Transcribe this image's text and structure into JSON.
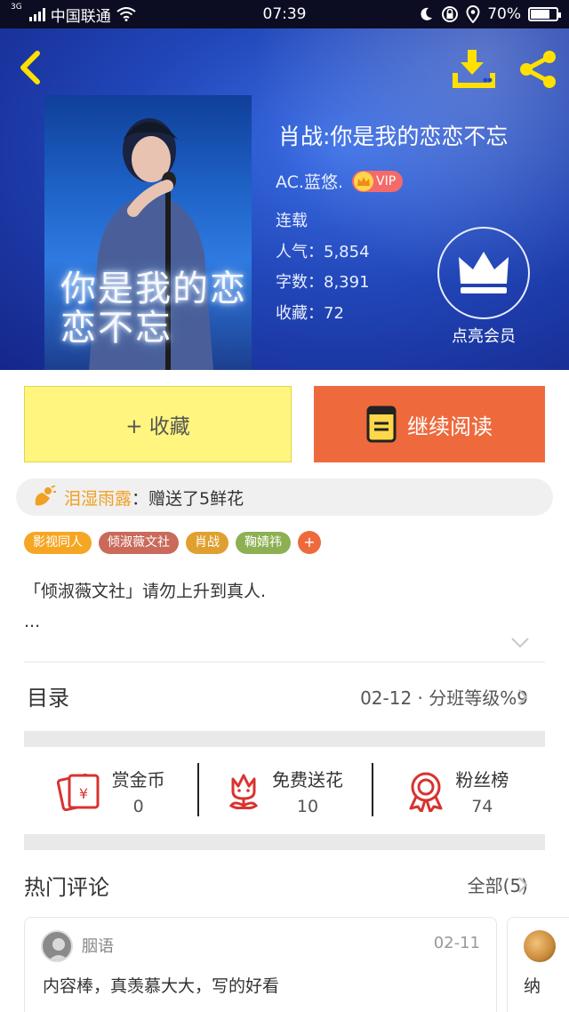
{
  "status_bar": {
    "network": "3G",
    "carrier": "中国联通",
    "time": "07:39",
    "battery": "70%"
  },
  "book": {
    "title": "肖战:你是我的恋恋不忘",
    "cover_title": "你是我的恋恋不忘",
    "author": "AC.蓝悠.",
    "vip_label": "VIP",
    "status": "连载",
    "popularity_label": "人气：",
    "popularity": "5,854",
    "words_label": "字数：",
    "words": "8,391",
    "favorites_label": "收藏：",
    "favorites": "72"
  },
  "member": {
    "label": "点亮会员"
  },
  "actions": {
    "favorite_label": "+ 收藏",
    "read_label": "继续阅读"
  },
  "flower_notice": {
    "user": "泪湿雨露",
    "text": "：赠送了5鲜花"
  },
  "tags": [
    {
      "label": "影视同人",
      "color": "#f5a623"
    },
    {
      "label": "倾淑薇文社",
      "color": "#c96a5b"
    },
    {
      "label": "肖战",
      "color": "#e0a030"
    },
    {
      "label": "鞠婧祎",
      "color": "#8cb052"
    }
  ],
  "tag_add": "+",
  "summary": {
    "text": "「倾淑薇文社」请勿上升到真人.",
    "more": "..."
  },
  "toc": {
    "label": "目录",
    "latest": "02-12 · 分班等级%9"
  },
  "rewards": [
    {
      "label": "赏金币",
      "value": "0"
    },
    {
      "label": "免费送花",
      "value": "10"
    },
    {
      "label": "粉丝榜",
      "value": "74"
    }
  ],
  "comments": {
    "title": "热门评论",
    "all_label": "全部(5)",
    "items": [
      {
        "user": "胭语",
        "date": "02-11",
        "text": "内容棒，真羡慕大大，写的好看"
      },
      {
        "text": "纳"
      }
    ]
  },
  "colors": {
    "accent_orange": "#ee6a3d",
    "favorite_yellow": "#fff57f",
    "hero_blue": "#2146b8",
    "reward_red": "#d8332f"
  },
  "icons": [
    "back-icon",
    "download-icon",
    "share-icon",
    "crown-icon",
    "book-icon",
    "flower-icon",
    "red-envelope-icon",
    "medal-icon",
    "chevron-right-icon",
    "chevron-down-icon"
  ]
}
